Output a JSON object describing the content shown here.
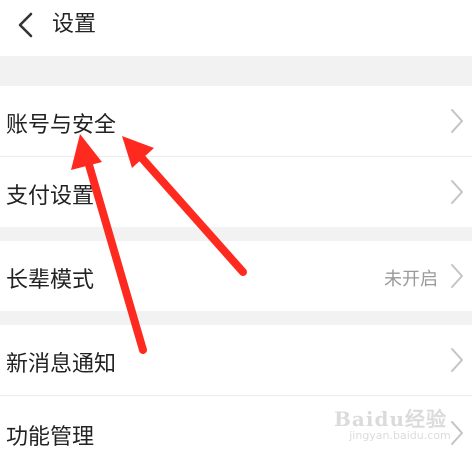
{
  "header": {
    "back_icon": "chevron-left-icon",
    "title": "设置"
  },
  "settings": {
    "items": [
      {
        "label": "账号与安全",
        "value": "",
        "icon": "chevron-right-icon"
      },
      {
        "label": "支付设置",
        "value": "",
        "icon": "chevron-right-icon"
      },
      {
        "label": "长辈模式",
        "value": "未开启",
        "icon": "chevron-right-icon"
      },
      {
        "label": "新消息通知",
        "value": "",
        "icon": "chevron-right-icon"
      },
      {
        "label": "功能管理",
        "value": "",
        "icon": "chevron-right-icon"
      }
    ]
  },
  "annotations": {
    "arrow_color": "#ff2a1f"
  },
  "watermark": {
    "brand": "Baidu经验",
    "url": "jingyan.baidu.com"
  },
  "colors": {
    "background": "#f2f2f2",
    "row_background": "#ffffff",
    "text": "#222222",
    "secondary_text": "#9a9a9a",
    "chevron": "#c4c4c4"
  }
}
